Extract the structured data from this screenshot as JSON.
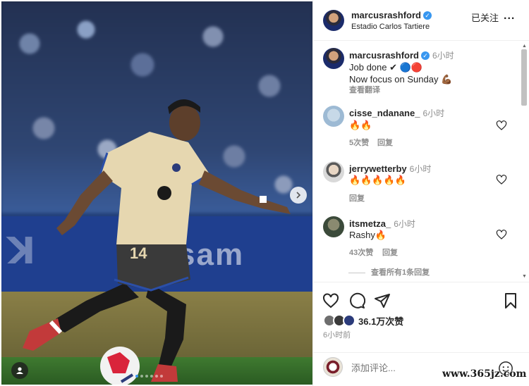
{
  "post": {
    "username": "marcusrashford",
    "location": "Estadio Carlos Tartiere",
    "follow_label": "已关注",
    "more_label": "...",
    "caption_line1": "Job done ✔ 🔵🔴",
    "caption_line2": "Now focus on Sunday 💪🏾",
    "caption_time": "6小时",
    "translate_label": "查看翻译",
    "jersey_number": "14"
  },
  "comments": [
    {
      "username": "cisse_ndanane_",
      "time": "6小时",
      "text": "🔥🔥",
      "likes": "5次赞",
      "reply": "回复"
    },
    {
      "username": "jerrywetterby",
      "time": "6小时",
      "text": "🔥🔥🔥🔥🔥",
      "likes": "",
      "reply": "回复"
    },
    {
      "username": "itsmetza_",
      "time": "6小时",
      "text": "Rashy🔥",
      "likes": "43次赞",
      "reply": "回复"
    }
  ],
  "view_replies": "查看所有1条回复",
  "likes_count": "36.1万次赞",
  "post_time": "6小时前",
  "comment_placeholder": "添加评论...",
  "watermark": "www.365jz.com",
  "board_text": "sam",
  "colors": {
    "verified": "#3897f0",
    "accent": "#3897f0",
    "kit": "#e6d7b0",
    "fire": "#ff6a00"
  }
}
